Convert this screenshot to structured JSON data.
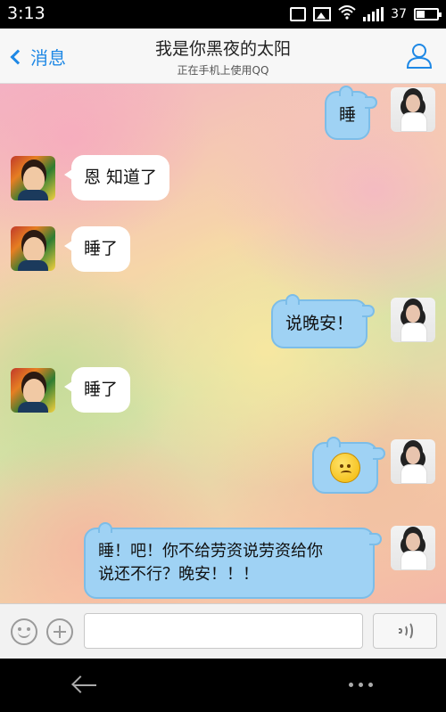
{
  "status_bar": {
    "time": "3:13",
    "battery_level": 37,
    "battery_text": "37",
    "icons": [
      "notification-icon",
      "image-icon",
      "wifi-icon",
      "signal-icon",
      "battery-icon"
    ]
  },
  "header": {
    "back_label": "消息",
    "title": "我是你黑夜的太阳",
    "subtitle": "正在手机上使用QQ",
    "profile_icon": "user-icon",
    "accent_color": "#1e88e5"
  },
  "messages": [
    {
      "side": "right",
      "text": "睡"
    },
    {
      "side": "left",
      "text": "恩 知道了"
    },
    {
      "side": "left",
      "text": "睡了"
    },
    {
      "side": "right",
      "text": "说晚安！"
    },
    {
      "side": "left",
      "text": "睡了"
    },
    {
      "side": "right",
      "emoji": "sad-face-emoji"
    },
    {
      "side": "right",
      "text_line1": "睡！吧！你不给劳资说劳资给你",
      "text_line2": "说还不行？晚安！！！"
    }
  ],
  "input_bar": {
    "emoji_icon": "smiley-icon",
    "plus_icon": "plus-icon",
    "input_value": "",
    "voice_icon": "voice-icon"
  },
  "colors": {
    "bubble_right": "#9fd2f4",
    "bubble_left": "#ffffff"
  }
}
